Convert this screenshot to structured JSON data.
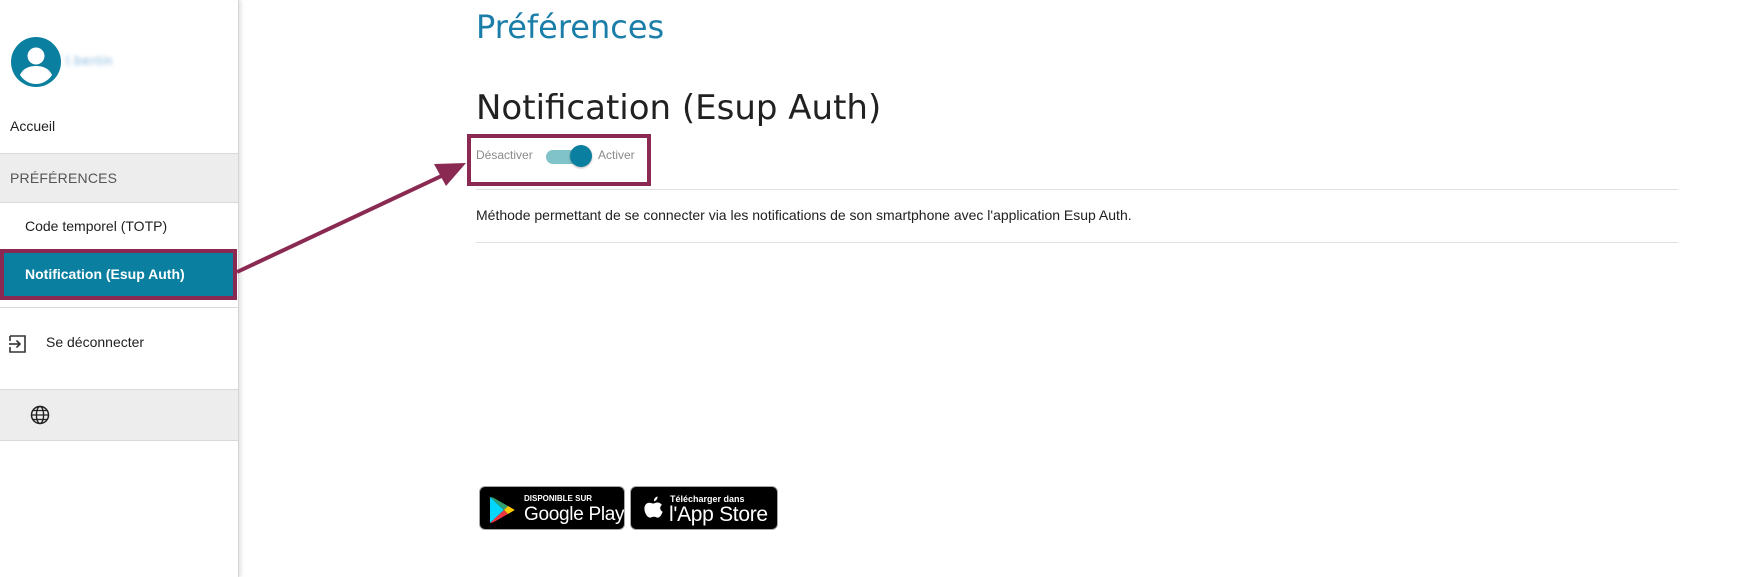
{
  "sidebar": {
    "username": "l.bertin",
    "nav": {
      "home_label": "Accueil",
      "section_label": "PRÉFÉRENCES",
      "totp_label": "Code temporel (TOTP)",
      "push_label": "Notification (Esup Auth)",
      "logout_label": "Se déconnecter"
    }
  },
  "main": {
    "page_title": "Préférences",
    "section_title": "Notification (Esup Auth)",
    "toggle": {
      "off_label": "Désactiver",
      "on_label": "Activer",
      "state": "on"
    },
    "description": "Méthode permettant de se connecter via les notifications de son smartphone avec l'application Esup Auth."
  },
  "badges": {
    "google": {
      "small": "DISPONIBLE SUR",
      "big": "Google Play"
    },
    "apple": {
      "small": "Télécharger dans",
      "big": "l'App Store"
    }
  },
  "colors": {
    "accent": "#0b7fa0",
    "title": "#1a7ea8",
    "annotation": "#8a2a52",
    "toggle_track": "#80c3c9"
  },
  "icons": [
    "account-circle-icon",
    "logout-icon",
    "globe-icon",
    "google-play-icon",
    "apple-icon"
  ]
}
